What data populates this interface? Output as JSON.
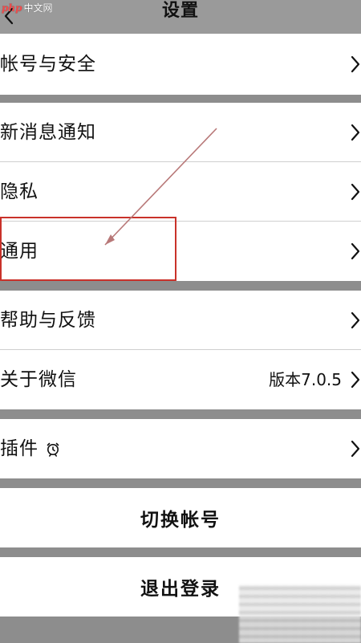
{
  "app": {
    "brand_prefix": "php",
    "brand_suffix": "中文网"
  },
  "header": {
    "title": "设置",
    "back_icon": "chevron-left-icon"
  },
  "sections": [
    {
      "items": [
        {
          "label": "帐号与安全",
          "value": "",
          "chevron": true
        }
      ]
    },
    {
      "items": [
        {
          "label": "新消息通知",
          "value": "",
          "chevron": true
        },
        {
          "label": "隐私",
          "value": "",
          "chevron": true
        },
        {
          "label": "通用",
          "value": "",
          "chevron": true
        }
      ]
    },
    {
      "items": [
        {
          "label": "帮助与反馈",
          "value": "",
          "chevron": true
        },
        {
          "label": "关于微信",
          "value": "版本7.0.5",
          "chevron": true
        }
      ]
    },
    {
      "items": [
        {
          "label": "插件",
          "value": "",
          "chevron": true,
          "icon": "plugin-alarm-icon"
        }
      ]
    },
    {
      "actions": [
        {
          "label": "切换帐号"
        }
      ]
    },
    {
      "actions": [
        {
          "label": "退出登录"
        }
      ]
    }
  ],
  "annotation": {
    "highlight_color": "#c9322a",
    "arrow_color": "#b87878"
  }
}
